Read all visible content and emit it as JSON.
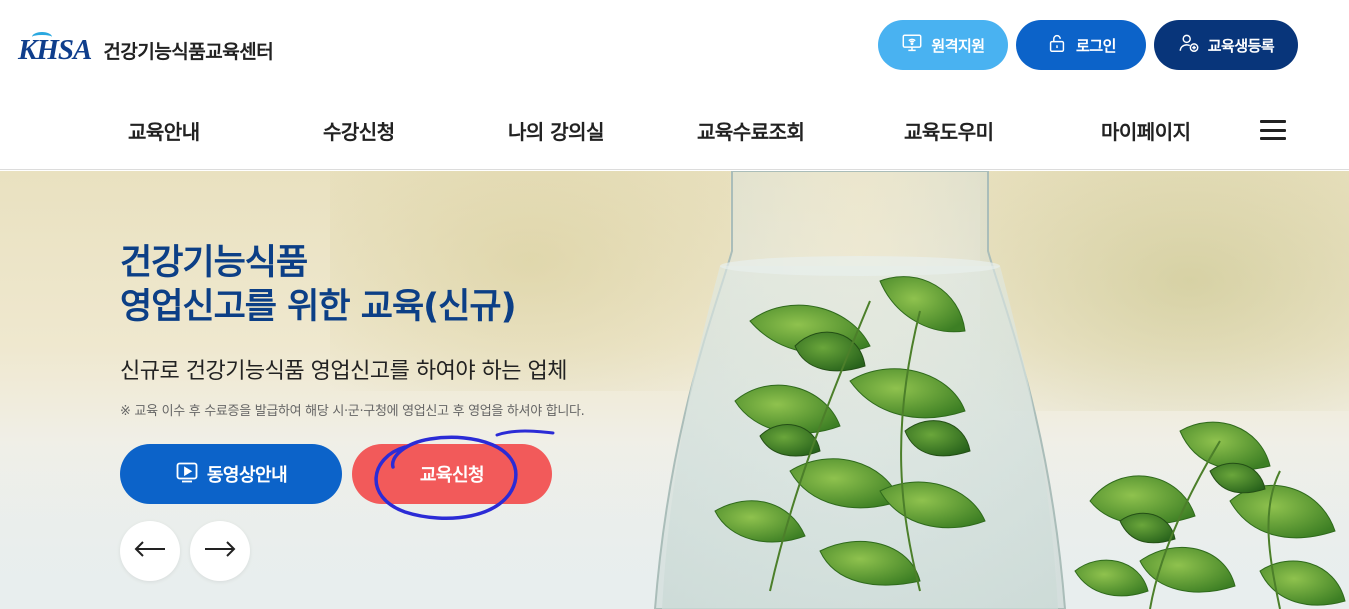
{
  "header": {
    "logo_text": "KHSA",
    "org_name": "건강기능식품교육센터",
    "buttons": {
      "remote": "원격지원",
      "login": "로그인",
      "register": "교육생등록"
    }
  },
  "nav": {
    "items": [
      "교육안내",
      "수강신청",
      "나의 강의실",
      "교육수료조회",
      "교육도우미",
      "마이페이지"
    ]
  },
  "hero": {
    "title_line1": "건강기능식품",
    "title_line2": "영업신고를 위한 교육(신규)",
    "subtitle": "신규로 건강기능식품 영업신고를 하여야 하는 업체",
    "note": "※ 교육 이수 후 수료증을 발급하여 해당 시·군·구청에 영업신고 후 영업을 하셔야 합니다.",
    "video_button": "동영상안내",
    "apply_button": "교육신청"
  },
  "colors": {
    "brand_navy": "#0c3f86",
    "primary_blue": "#0c63c9",
    "sky_blue": "#49b2f1",
    "dark_navy": "#08357a",
    "apply_red": "#f25a5a",
    "annotation_ink": "#2b2bd6"
  },
  "icons": {
    "remote": "monitor-wifi-icon",
    "login": "lock-icon",
    "register": "user-plus-icon",
    "video": "play-screen-icon",
    "prev": "arrow-left-icon",
    "next": "arrow-right-icon",
    "menu": "hamburger-menu-icon"
  }
}
